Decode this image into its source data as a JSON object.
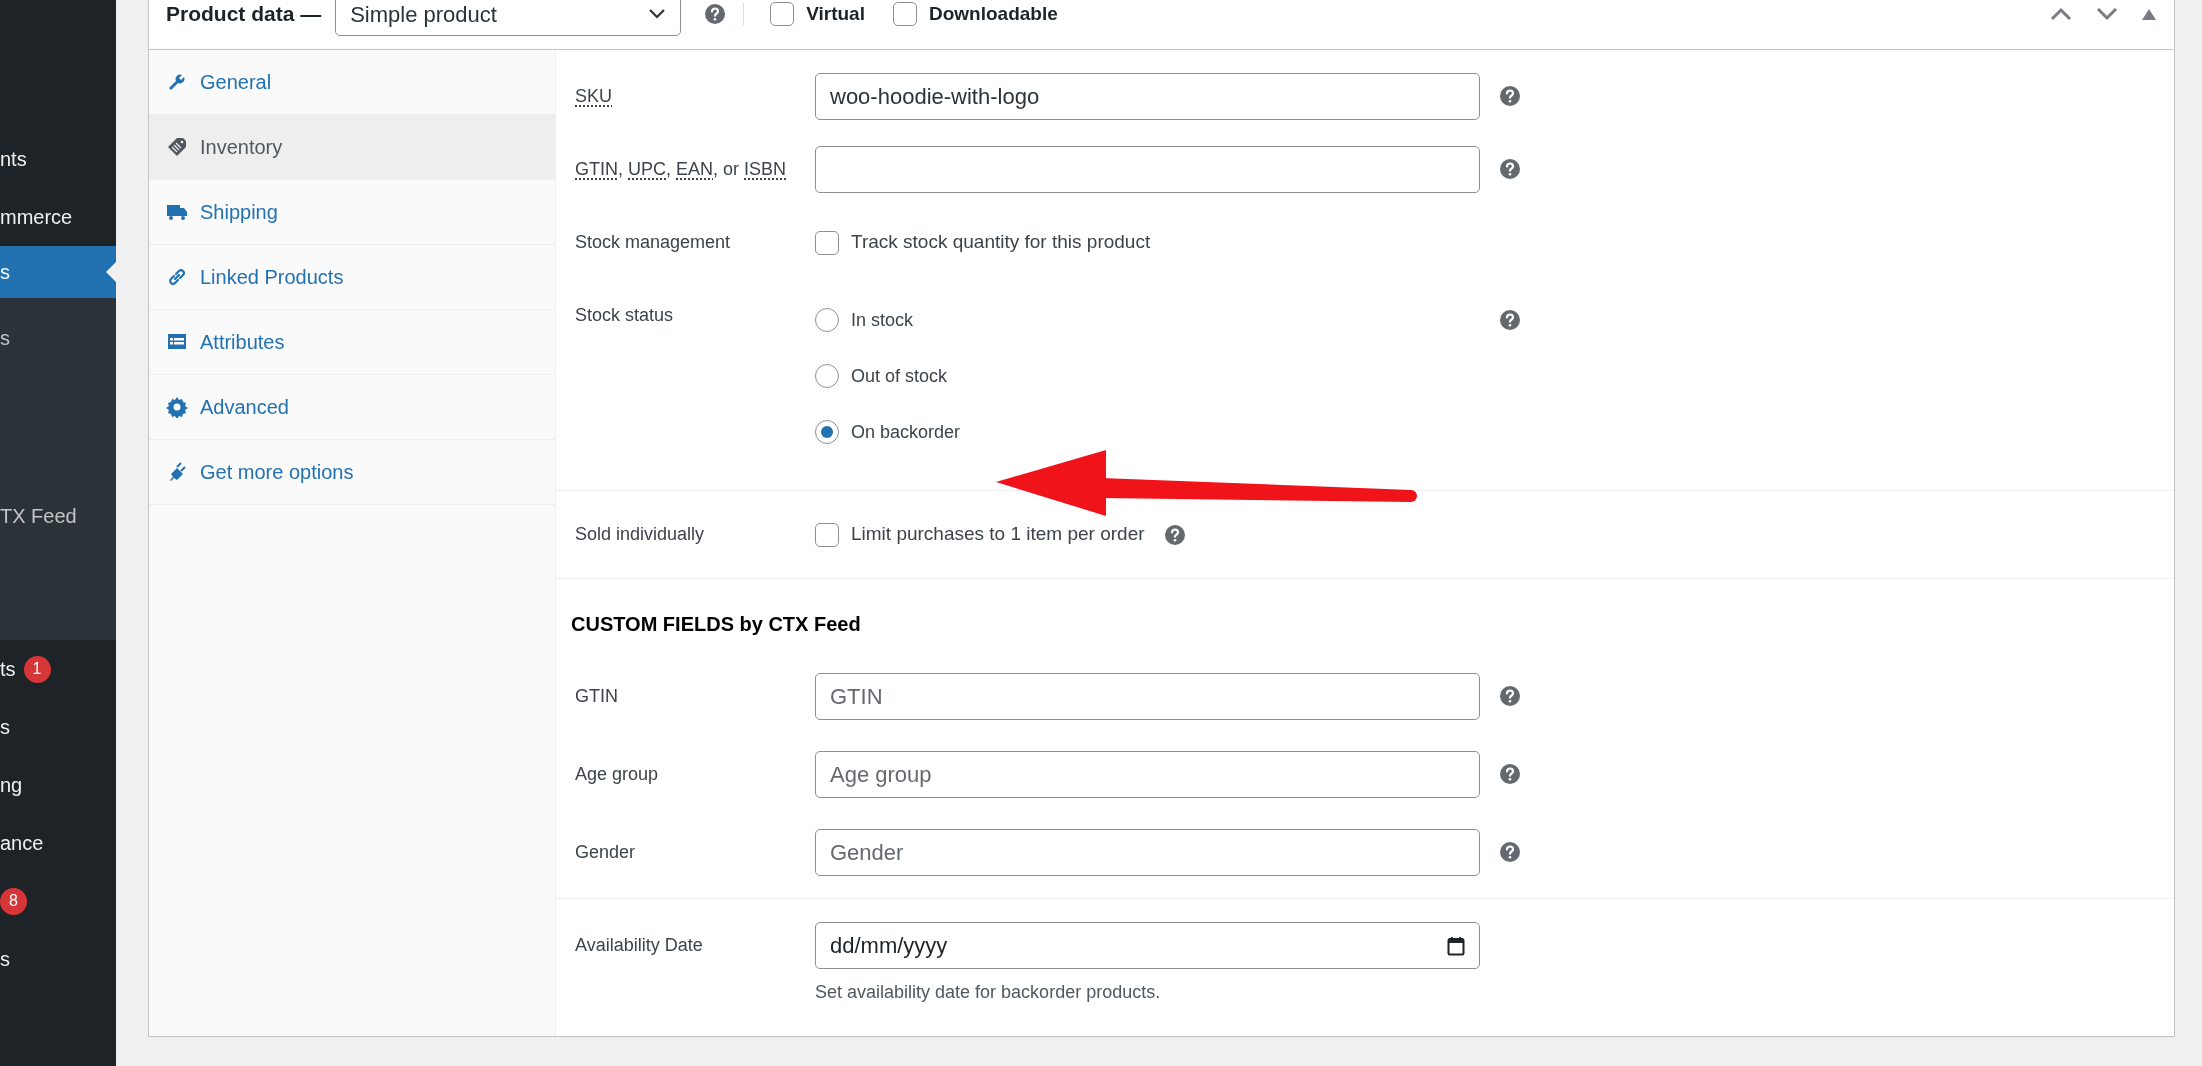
{
  "admin_menu": [
    {
      "kind": "item",
      "label": "nts",
      "selected": false
    },
    {
      "kind": "item",
      "label": "mmerce",
      "selected": false
    },
    {
      "kind": "item",
      "label": "s",
      "selected": true
    },
    {
      "kind": "subitem",
      "label": "s",
      "selected": false
    },
    {
      "kind": "subitem",
      "label": "TX Feed",
      "selected": false
    },
    {
      "kind": "item",
      "label": "ts",
      "badge": "1",
      "selected": false
    },
    {
      "kind": "item",
      "label": "s",
      "selected": false
    },
    {
      "kind": "item",
      "label": "ng",
      "selected": false
    },
    {
      "kind": "item",
      "label": "ance",
      "selected": false
    },
    {
      "kind": "item",
      "badge": "8",
      "selected": false
    },
    {
      "kind": "item",
      "label": "s",
      "selected": false
    }
  ],
  "product_data": {
    "title": "Product data —",
    "type_select": "Simple product",
    "options": [
      {
        "label": "Virtual",
        "checked": false
      },
      {
        "label": "Downloadable",
        "checked": false
      }
    ]
  },
  "tabs": [
    {
      "kind": "wrench",
      "label": "General",
      "selected": false
    },
    {
      "kind": "tag",
      "label": "Inventory",
      "selected": true
    },
    {
      "kind": "truck",
      "label": "Shipping",
      "selected": false
    },
    {
      "kind": "link",
      "label": "Linked Products",
      "selected": false
    },
    {
      "kind": "list",
      "label": "Attributes",
      "selected": false
    },
    {
      "kind": "gear",
      "label": "Advanced",
      "selected": false
    },
    {
      "kind": "plug",
      "label": "Get more options",
      "selected": false
    }
  ],
  "inventory": [
    {
      "rows": [
        {
          "kind": "text",
          "label_parts": [
            {
              "text": "SKU",
              "abbr": true
            }
          ],
          "value": "woo-hoodie-with-logo",
          "help": true
        },
        {
          "kind": "text",
          "label_parts": [
            {
              "text": "GTIN",
              "abbr": true
            },
            {
              "text": ", ",
              "abbr": false
            },
            {
              "text": "UPC",
              "abbr": true
            },
            {
              "text": ", ",
              "abbr": false
            },
            {
              "text": "EAN",
              "abbr": true
            },
            {
              "text": ", or ",
              "abbr": false
            },
            {
              "text": "ISBN",
              "abbr": true
            }
          ],
          "help": true
        },
        {
          "kind": "checkbox",
          "label": "Stock management",
          "option": "Track stock quantity for this product",
          "checked": false
        },
        {
          "kind": "radio",
          "label": "Stock status",
          "help": true,
          "options": [
            {
              "label": "In stock",
              "selected": false
            },
            {
              "label": "Out of stock",
              "selected": false
            },
            {
              "label": "On backorder",
              "selected": true
            }
          ]
        }
      ]
    },
    {
      "rows": [
        {
          "kind": "checkbox",
          "label": "Sold individually",
          "option": "Limit purchases to 1 item per order",
          "checked": false,
          "help": true
        }
      ]
    }
  ],
  "custom_fields": {
    "heading": "CUSTOM FIELDS by CTX Feed",
    "rows": [
      {
        "label": "GTIN",
        "placeholder": "GTIN",
        "help": true
      },
      {
        "label": "Age group",
        "placeholder": "Age group",
        "help": true
      },
      {
        "label": "Gender",
        "placeholder": "Gender",
        "help": true
      }
    ]
  },
  "availability": {
    "label": "Availability Date",
    "value": "dd/mm/yyyy",
    "description": "Set availability date for backorder products."
  }
}
